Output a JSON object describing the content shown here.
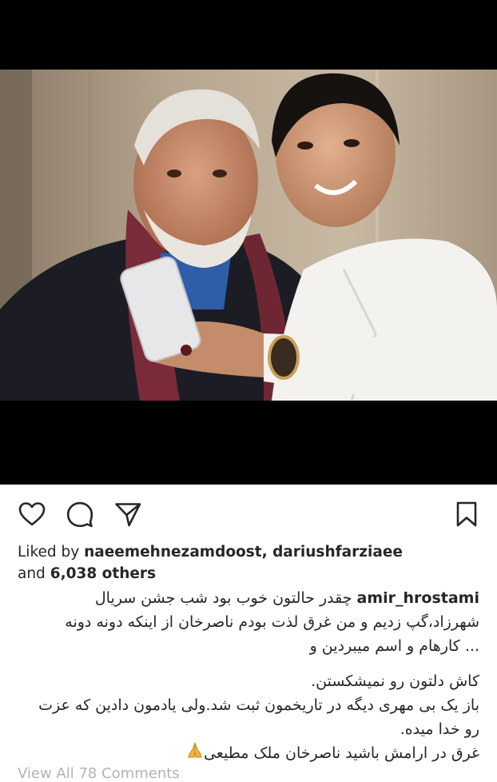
{
  "post": {
    "liked_by_prefix": "Liked by",
    "liked_by_users": "naeemehnezamdoost, dariushfarziaee",
    "and_text": "and",
    "others_count": "6,038 others",
    "username": "amir_hrostami",
    "caption_lines": [
      "چقدر حالتون خوب بود شب جشن سریال",
      "شهرزاد،گپ زدیم و من غرق لذت بودم ناصرخان از اینکه دونه دونه",
      "... کارهام و اسم میبردین و",
      "کاش دلتون رو نمیشکستن.",
      "باز یک بی مهری دیگه در تاریخمون ثبت شد.ولی یادمون دادین که عزت",
      "رو خدا میده.",
      "غرق در ارامش باشید ناصرخان ملک مطیعی"
    ],
    "view_all_comments": "View All 78 Comments"
  },
  "icons": {
    "like": "heart-outline-icon",
    "comment": "speech-bubble-icon",
    "share": "paper-plane-icon",
    "save": "bookmark-icon",
    "emoji": "folded-hands-emoji"
  }
}
